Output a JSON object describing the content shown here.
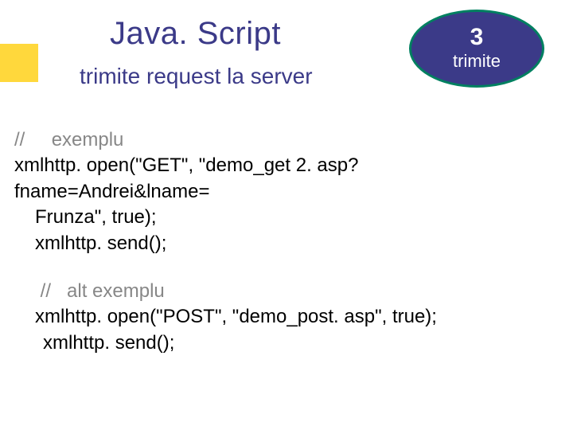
{
  "title": "Java. Script",
  "subtitle": "trimite request la server",
  "badge": {
    "number": "3",
    "label": "trimite"
  },
  "code": {
    "ex1_slashes": "//",
    "ex1_comment": "exemplu",
    "ex1_line1": "xmlhttp. open(\"GET\", \"demo_get 2. asp? fname=Andrei&lname=",
    "ex1_line2": "Frunza\", true);",
    "ex1_line3": "xmlhttp. send();",
    "ex2_slashes": "//",
    "ex2_comment": "alt  exemplu",
    "ex2_line1": "xmlhttp. open(\"POST\", \"demo_post. asp\", true);",
    "ex2_line2": "xmlhttp. send();"
  }
}
